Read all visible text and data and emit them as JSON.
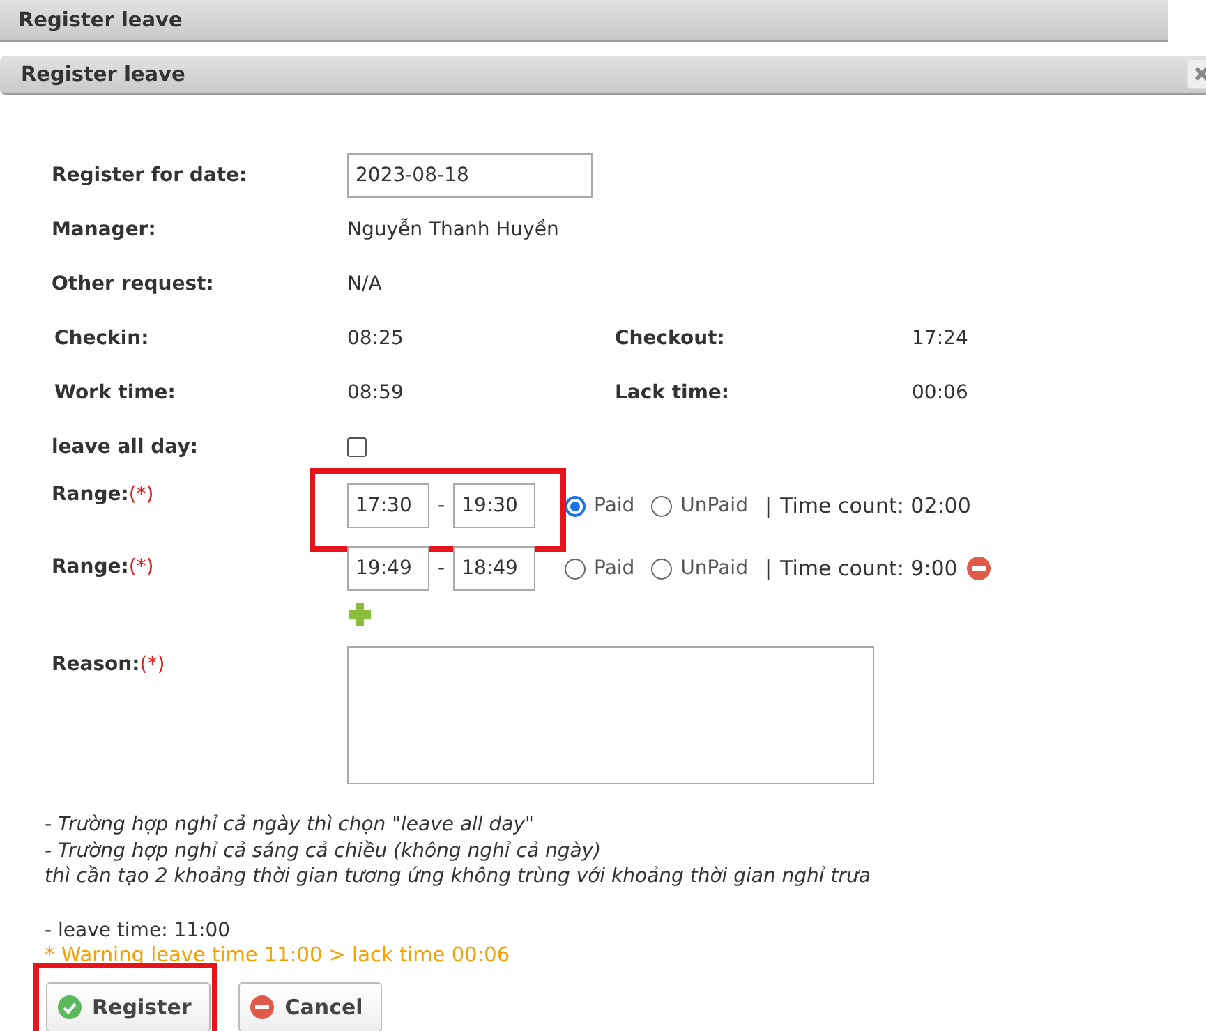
{
  "page_title": "Register leave",
  "dialog": {
    "title": "Register leave",
    "fields": [
      {
        "kind": "input",
        "label": "Register for date:",
        "value": "2023-08-18"
      },
      {
        "kind": "text",
        "label": "Manager:",
        "value": "Nguyễn Thanh Huyền"
      },
      {
        "kind": "text",
        "label": "Other request:",
        "value": "N/A"
      },
      {
        "kind": "pair",
        "label": "Checkin:",
        "value": "08:25",
        "label2": "Checkout:",
        "value2": "17:24"
      },
      {
        "kind": "pair",
        "label": "Work time:",
        "value": "08:59",
        "label2": "Lack time:",
        "value2": "00:06"
      },
      {
        "kind": "checkbox",
        "label": "leave all day:",
        "checked": false
      }
    ],
    "ranges": [
      {
        "label": "Range:",
        "required_mark": "(*)",
        "from": "17:30",
        "separator": "-",
        "to": "19:30",
        "highlighted": true,
        "options": [
          {
            "label": "Paid",
            "selected": true
          },
          {
            "label": "UnPaid",
            "selected": false
          }
        ],
        "divider": "|",
        "time_count": "Time count: 02:00",
        "removable": false
      },
      {
        "label": "Range:",
        "required_mark": "(*)",
        "from": "19:49",
        "separator": "-",
        "to": "18:49",
        "highlighted": false,
        "options": [
          {
            "label": "Paid",
            "selected": false
          },
          {
            "label": "UnPaid",
            "selected": false
          }
        ],
        "divider": "|",
        "time_count": "Time count: 9:00",
        "removable": true
      }
    ],
    "reason": {
      "label": "Reason:",
      "required_mark": "(*)"
    },
    "notes": [
      "- Trường hợp nghỉ cả ngày thì chọn \"leave all day\"",
      "- Trường hợp nghỉ cả sáng cả chiều (không nghỉ cả ngày)",
      "thì cần tạo 2 khoảng thời gian tương ứng không trùng với khoảng thời gian nghỉ trưa"
    ],
    "leave_time": "- leave time: 11:00",
    "warning": "* Warning leave time 11:00 > lack time 00:06",
    "buttons": [
      {
        "kind": "ok",
        "label": "Register",
        "highlighted": true
      },
      {
        "kind": "cancel",
        "label": "Cancel",
        "highlighted": false
      }
    ]
  }
}
